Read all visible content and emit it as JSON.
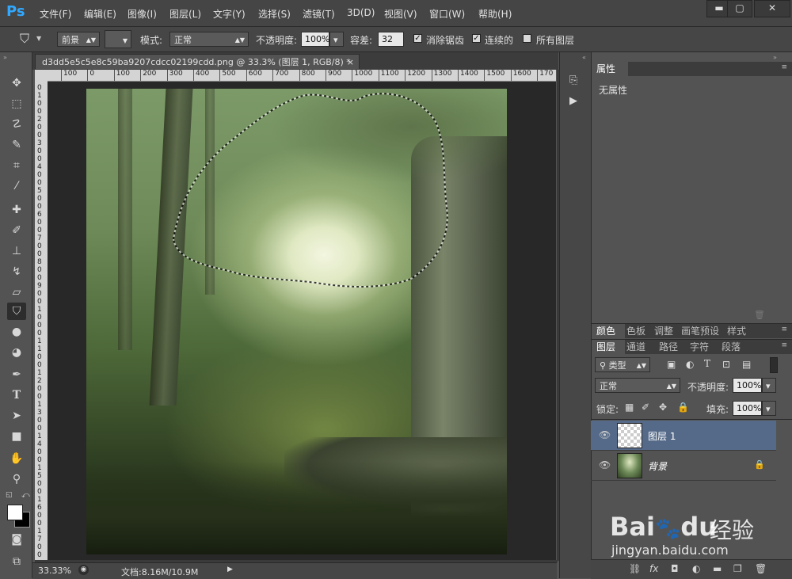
{
  "app": {
    "logo": "Ps"
  },
  "menu": [
    "文件(F)",
    "编辑(E)",
    "图像(I)",
    "图层(L)",
    "文字(Y)",
    "选择(S)",
    "滤镜(T)",
    "3D(D)",
    "视图(V)",
    "窗口(W)",
    "帮助(H)"
  ],
  "window_controls": {
    "minimize": "▬",
    "maximize": "▢",
    "close": "✕"
  },
  "options": {
    "fill_source": "前景",
    "mode_label": "模式:",
    "mode_value": "正常",
    "opacity_label": "不透明度:",
    "opacity_value": "100%",
    "tolerance_label": "容差:",
    "tolerance_value": "32",
    "antialias_label": "消除锯齿",
    "contiguous_label": "连续的",
    "all_layers_label": "所有图层"
  },
  "document": {
    "tab_title": "d3dd5e5c5e8c59ba9207cdcc02199cdd.png @ 33.3% (图层 1, RGB/8) *",
    "tab_close": "×",
    "ruler_top": [
      "100",
      "0",
      "100",
      "200",
      "300",
      "400",
      "500",
      "600",
      "700",
      "800",
      "900",
      "1000",
      "1100",
      "1200",
      "1300",
      "1400",
      "1500",
      "1600",
      "170"
    ],
    "ruler_left": [
      "0",
      "1",
      "0",
      "0",
      "2",
      "0",
      "0",
      "3",
      "0",
      "0",
      "4",
      "0",
      "0",
      "5",
      "0",
      "0",
      "6",
      "0",
      "0",
      "7",
      "0",
      "0",
      "8",
      "0",
      "0",
      "9",
      "0",
      "0",
      "1",
      "0",
      "0",
      "0",
      "1",
      "1",
      "0",
      "0",
      "1",
      "2",
      "0",
      "0",
      "1",
      "3",
      "0",
      "0",
      "1",
      "4",
      "0",
      "0",
      "1",
      "5",
      "0",
      "0",
      "1",
      "6",
      "0",
      "0",
      "1",
      "7",
      "0",
      "0"
    ]
  },
  "status": {
    "zoom": "33.33%",
    "doc_info": "文档:8.16M/10.9M"
  },
  "properties_panel": {
    "tab": "属性",
    "content": "无属性"
  },
  "color_panel_tabs": [
    "颜色",
    "色板",
    "调整",
    "画笔预设",
    "样式"
  ],
  "layers_panel_tabs": [
    "图层",
    "通道",
    "路径",
    "字符",
    "段落"
  ],
  "layers_panel": {
    "filter_type": "类型",
    "blend_mode": "正常",
    "opacity_label": "不透明度:",
    "opacity_value": "100%",
    "lock_label": "锁定:",
    "fill_label": "填充:",
    "fill_value": "100%",
    "layers": [
      {
        "name": "图层 1",
        "selected": true
      },
      {
        "name": "背景",
        "selected": false
      }
    ]
  },
  "watermark": {
    "brand": "Bai",
    "brand2": "du",
    "suffix": "经验",
    "url": "jingyan.baidu.com"
  },
  "colors": {
    "selected_layer": "#556a88",
    "logo": "#31a8ff"
  }
}
